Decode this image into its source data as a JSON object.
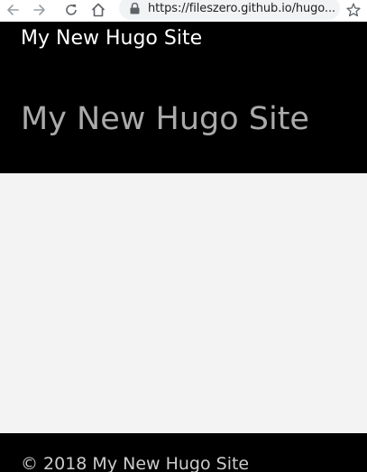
{
  "browser": {
    "url": "https://fileszero.github.io/hugo...",
    "icons": {
      "back": "back-arrow-icon",
      "forward": "forward-arrow-icon",
      "reload": "reload-icon",
      "home": "home-icon",
      "lock": "lock-icon",
      "bookmark": "star-icon"
    }
  },
  "header": {
    "site_title": "My New Hugo Site",
    "hero_title": "My New Hugo Site"
  },
  "footer": {
    "copyright": "© 2018 My New Hugo Site"
  },
  "colors": {
    "header_bg": "#000000",
    "hero_text": "#aaaaaa",
    "page_bg": "#f3f3f3",
    "footer_text": "#cccccc"
  }
}
